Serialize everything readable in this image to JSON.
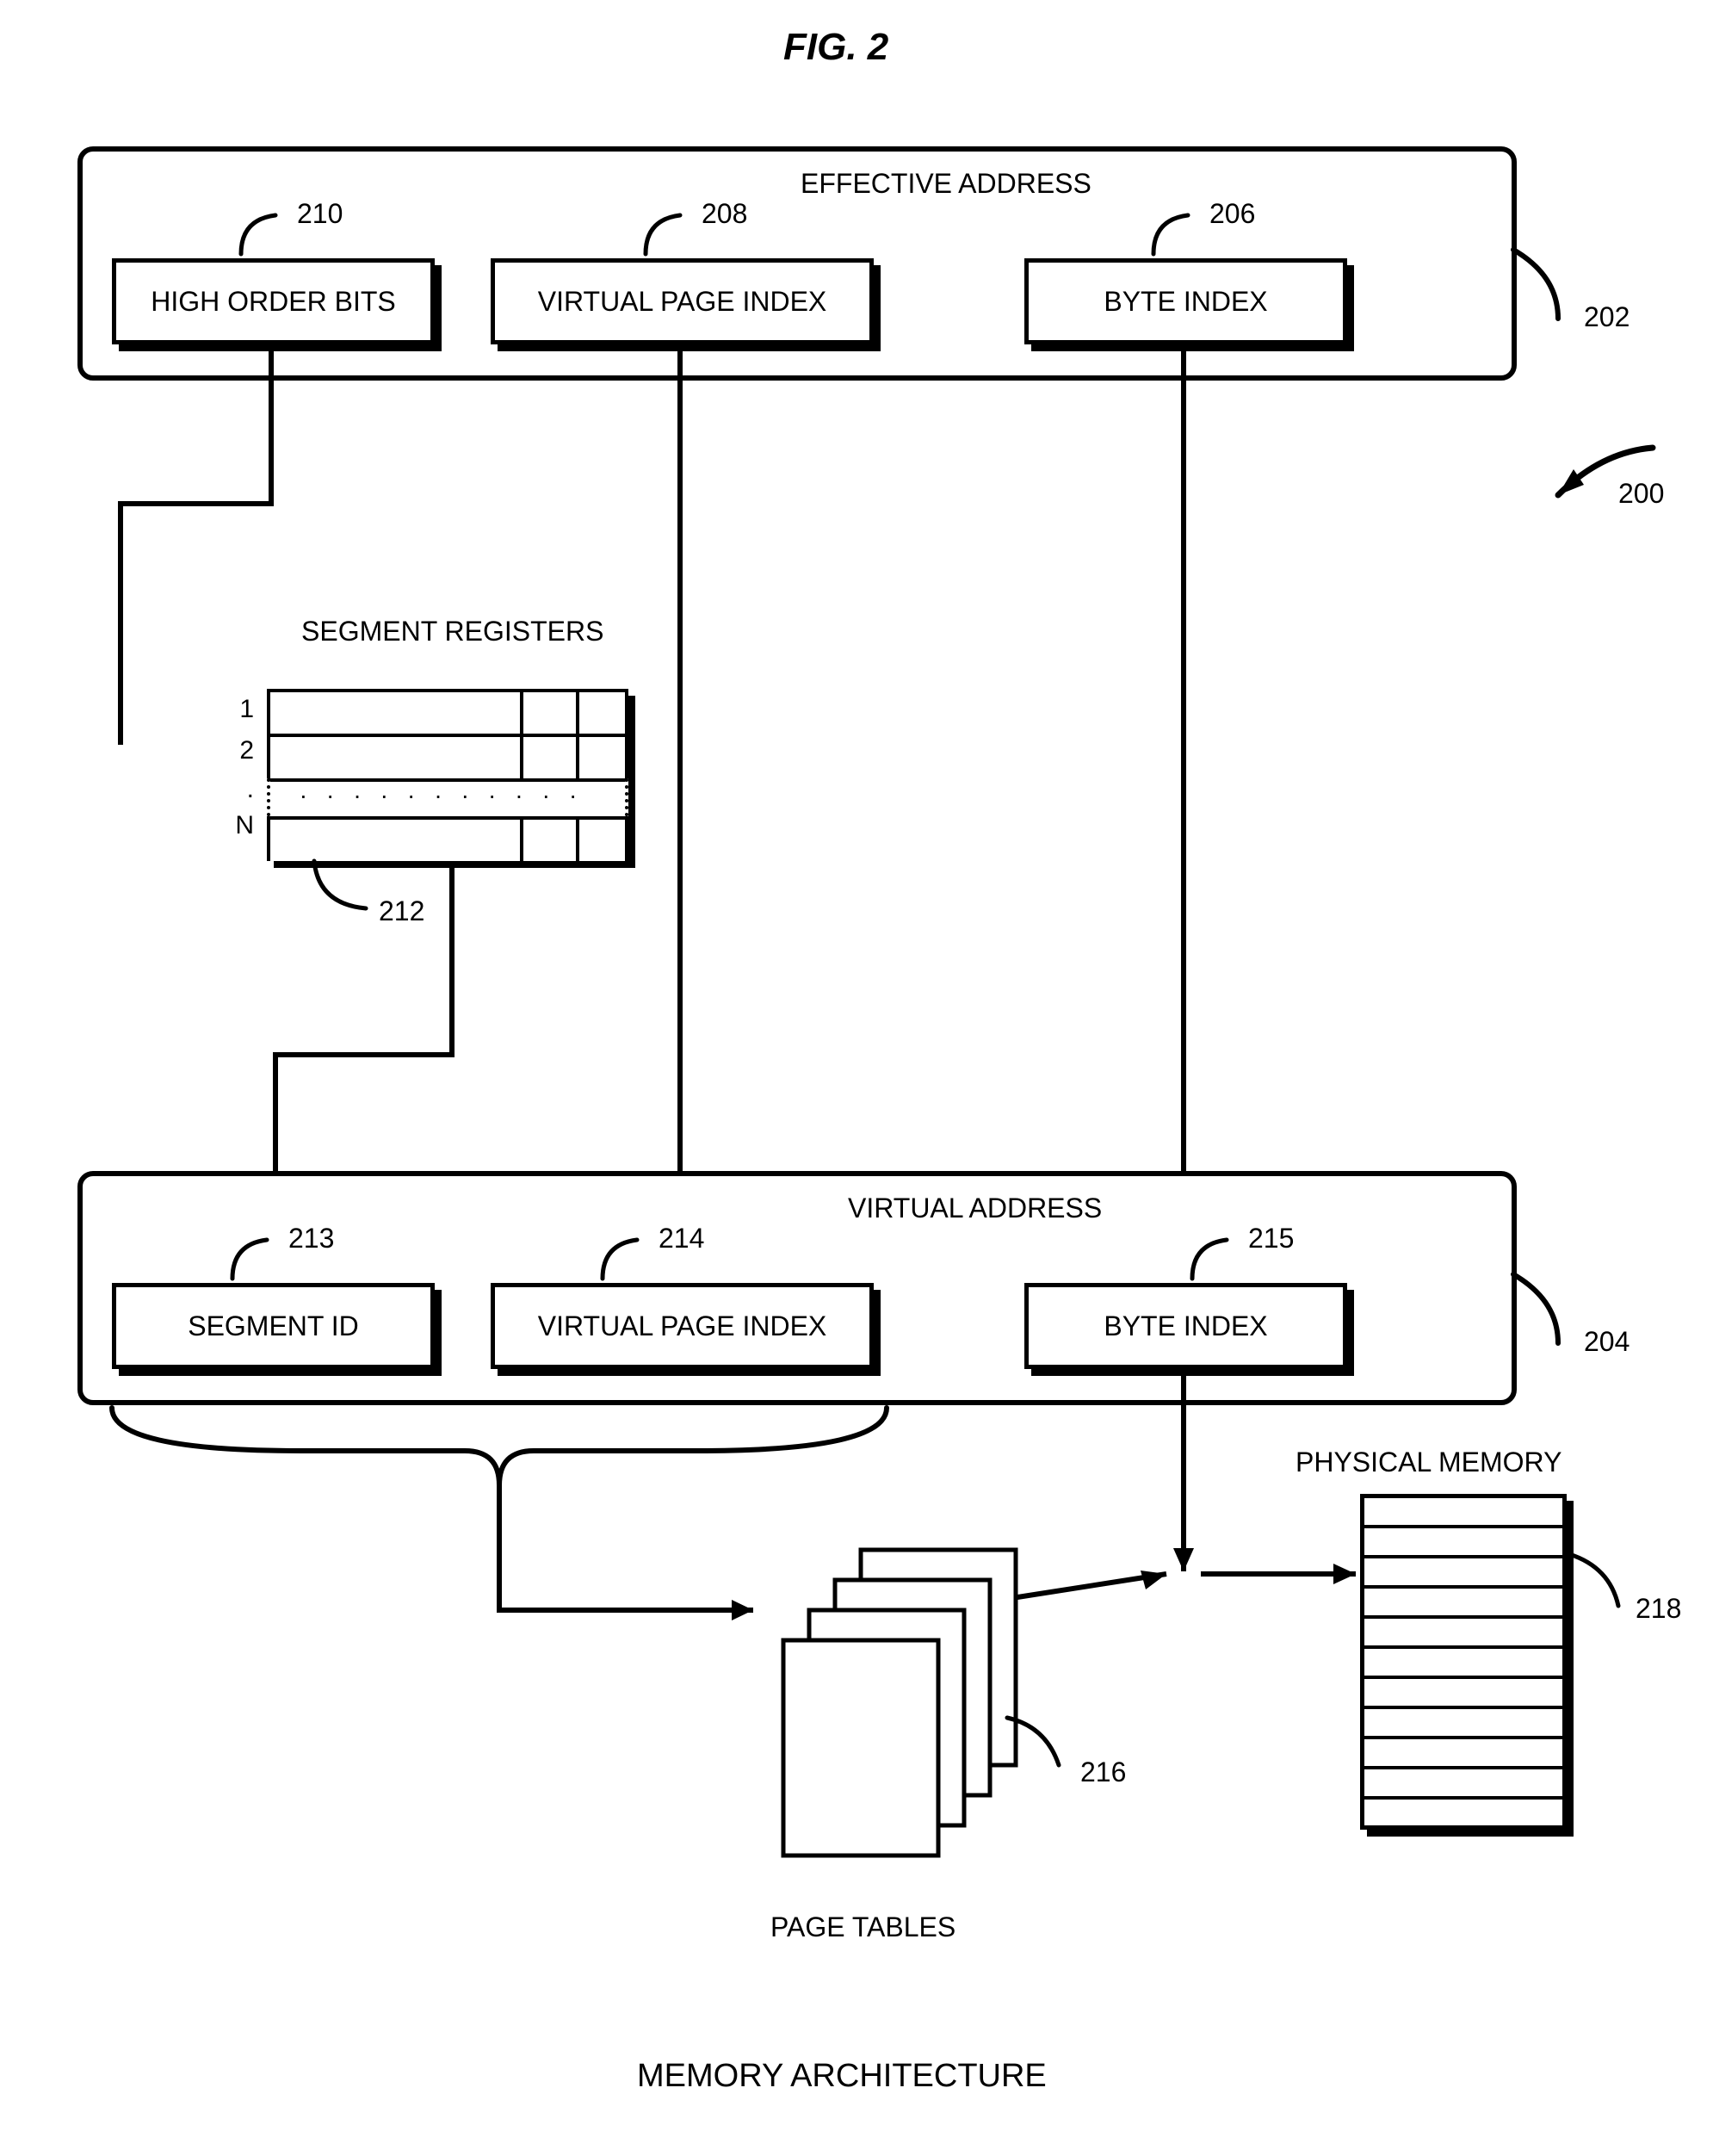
{
  "figure_label": "FIG. 2",
  "title": "MEMORY ARCHITECTURE",
  "effective_address": {
    "title": "EFFECTIVE ADDRESS",
    "ref": "202",
    "whole_ref": "200",
    "fields": {
      "high_order_bits": {
        "label": "HIGH ORDER BITS",
        "ref": "210"
      },
      "virtual_page_index": {
        "label": "VIRTUAL PAGE INDEX",
        "ref": "208"
      },
      "byte_index": {
        "label": "BYTE INDEX",
        "ref": "206"
      }
    }
  },
  "segment_registers": {
    "title": "SEGMENT REGISTERS",
    "ref": "212",
    "row_labels": [
      "1",
      "2",
      ".",
      "N"
    ]
  },
  "virtual_address": {
    "title": "VIRTUAL ADDRESS",
    "ref": "204",
    "fields": {
      "segment_id": {
        "label": "SEGMENT ID",
        "ref": "213"
      },
      "virtual_page_index": {
        "label": "VIRTUAL PAGE INDEX",
        "ref": "214"
      },
      "byte_index": {
        "label": "BYTE INDEX",
        "ref": "215"
      }
    }
  },
  "page_tables": {
    "title": "PAGE TABLES",
    "ref": "216"
  },
  "physical_memory": {
    "title": "PHYSICAL MEMORY",
    "ref": "218"
  }
}
